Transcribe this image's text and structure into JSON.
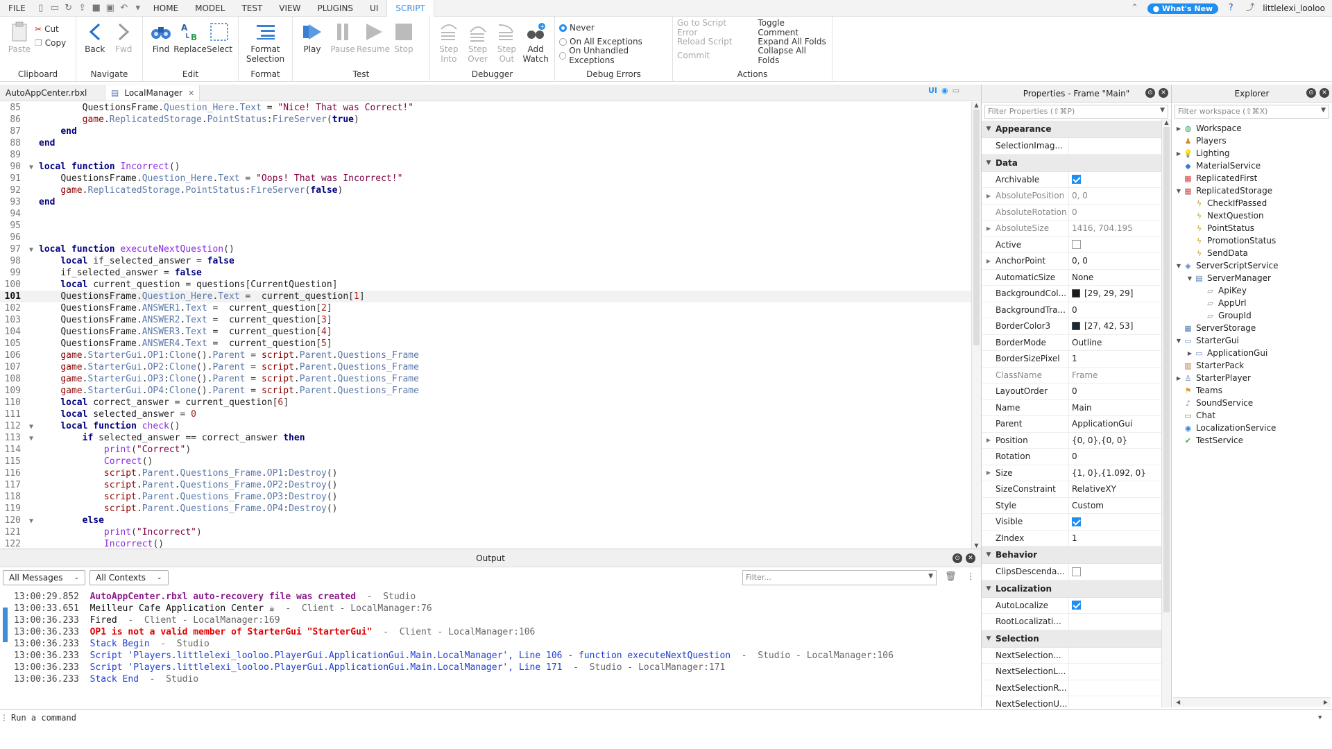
{
  "menubar": {
    "tabs": [
      "FILE",
      "HOME",
      "MODEL",
      "TEST",
      "VIEW",
      "PLUGINS",
      "UI",
      "SCRIPT"
    ],
    "active_tab": "SCRIPT",
    "whats_new": "What's New",
    "username": "littlelexi_looloo"
  },
  "ribbon": {
    "clipboard": {
      "label": "Clipboard",
      "paste": "Paste",
      "cut": "Cut",
      "copy": "Copy"
    },
    "navigate": {
      "label": "Navigate",
      "back": "Back",
      "fwd": "Fwd"
    },
    "edit": {
      "label": "Edit",
      "find": "Find",
      "replace": "Replace",
      "select": "Select"
    },
    "format": {
      "label": "Format",
      "format_selection": "Format Selection"
    },
    "test": {
      "label": "Test",
      "play": "Play",
      "pause": "Pause",
      "resume": "Resume",
      "stop": "Stop"
    },
    "debugger": {
      "label": "Debugger",
      "step_into": "Step Into",
      "step_over": "Step Over",
      "step_out": "Step Out",
      "add_watch": "Add Watch"
    },
    "debug_errors": {
      "label": "Debug Errors",
      "never": "Never",
      "all_exceptions": "On All Exceptions",
      "unhandled": "On Unhandled Exceptions",
      "selected": "Never"
    },
    "actions": {
      "label": "Actions",
      "goto_error": "Go to Script Error",
      "reload": "Reload Script",
      "commit": "Commit",
      "toggle_comment": "Toggle Comment",
      "expand_folds": "Expand All Folds",
      "collapse_folds": "Collapse All Folds"
    }
  },
  "doc_tabs": [
    {
      "label": "AutoAppCenter.rbxl",
      "close": "✕"
    },
    {
      "label": "LocalManager",
      "close": "✕"
    }
  ],
  "ui_toggle": "UI",
  "editor": {
    "current_line": 101,
    "lines": [
      {
        "n": 85,
        "code": "        QuestionsFrame.Question_Here.Text = \"Nice! That was Correct!\"",
        "fold": ""
      },
      {
        "n": 86,
        "code": "        game.ReplicatedStorage.PointStatus:FireServer(true)",
        "fold": ""
      },
      {
        "n": 87,
        "code": "    end",
        "fold": ""
      },
      {
        "n": 88,
        "code": "end",
        "fold": ""
      },
      {
        "n": 89,
        "code": "",
        "fold": ""
      },
      {
        "n": 90,
        "code": "local function Incorrect()",
        "fold": "▼"
      },
      {
        "n": 91,
        "code": "    QuestionsFrame.Question_Here.Text = \"Oops! That was Incorrect!\"",
        "fold": ""
      },
      {
        "n": 92,
        "code": "    game.ReplicatedStorage.PointStatus:FireServer(false)",
        "fold": ""
      },
      {
        "n": 93,
        "code": "end",
        "fold": ""
      },
      {
        "n": 94,
        "code": "",
        "fold": ""
      },
      {
        "n": 95,
        "code": "",
        "fold": ""
      },
      {
        "n": 96,
        "code": "",
        "fold": ""
      },
      {
        "n": 97,
        "code": "local function executeNextQuestion()",
        "fold": "▼"
      },
      {
        "n": 98,
        "code": "    local if_selected_answer = false",
        "fold": ""
      },
      {
        "n": 99,
        "code": "    if_selected_answer = false",
        "fold": ""
      },
      {
        "n": 100,
        "code": "    local current_question = questions[CurrentQuestion]",
        "fold": ""
      },
      {
        "n": 101,
        "code": "    QuestionsFrame.Question_Here.Text =  current_question[1]",
        "fold": ""
      },
      {
        "n": 102,
        "code": "    QuestionsFrame.ANSWER1.Text =  current_question[2]",
        "fold": ""
      },
      {
        "n": 103,
        "code": "    QuestionsFrame.ANSWER2.Text =  current_question[3]",
        "fold": ""
      },
      {
        "n": 104,
        "code": "    QuestionsFrame.ANSWER3.Text =  current_question[4]",
        "fold": ""
      },
      {
        "n": 105,
        "code": "    QuestionsFrame.ANSWER4.Text =  current_question[5]",
        "fold": ""
      },
      {
        "n": 106,
        "code": "    game.StarterGui.OP1:Clone().Parent = script.Parent.Questions_Frame",
        "fold": ""
      },
      {
        "n": 107,
        "code": "    game.StarterGui.OP2:Clone().Parent = script.Parent.Questions_Frame",
        "fold": ""
      },
      {
        "n": 108,
        "code": "    game.StarterGui.OP3:Clone().Parent = script.Parent.Questions_Frame",
        "fold": ""
      },
      {
        "n": 109,
        "code": "    game.StarterGui.OP4:Clone().Parent = script.Parent.Questions_Frame",
        "fold": ""
      },
      {
        "n": 110,
        "code": "    local correct_answer = current_question[6]",
        "fold": ""
      },
      {
        "n": 111,
        "code": "    local selected_answer = 0",
        "fold": ""
      },
      {
        "n": 112,
        "code": "    local function check()",
        "fold": "▼"
      },
      {
        "n": 113,
        "code": "        if selected_answer == correct_answer then",
        "fold": "▼"
      },
      {
        "n": 114,
        "code": "            print(\"Correct\")",
        "fold": ""
      },
      {
        "n": 115,
        "code": "            Correct()",
        "fold": ""
      },
      {
        "n": 116,
        "code": "            script.Parent.Questions_Frame.OP1:Destroy()",
        "fold": ""
      },
      {
        "n": 117,
        "code": "            script.Parent.Questions_Frame.OP2:Destroy()",
        "fold": ""
      },
      {
        "n": 118,
        "code": "            script.Parent.Questions_Frame.OP3:Destroy()",
        "fold": ""
      },
      {
        "n": 119,
        "code": "            script.Parent.Questions_Frame.OP4:Destroy()",
        "fold": ""
      },
      {
        "n": 120,
        "code": "        else",
        "fold": "▼"
      },
      {
        "n": 121,
        "code": "            print(\"Incorrect\")",
        "fold": ""
      },
      {
        "n": 122,
        "code": "            Incorrect()",
        "fold": ""
      }
    ]
  },
  "properties": {
    "title": "Properties - Frame \"Main\"",
    "filter_placeholder": "Filter Properties (⇧⌘P)",
    "sections": [
      {
        "name": "Appearance",
        "rows": [
          {
            "name": "SelectionImag...",
            "value": "",
            "kind": "text"
          }
        ]
      },
      {
        "name": "Data",
        "rows": [
          {
            "name": "Archivable",
            "value": "true",
            "kind": "check"
          },
          {
            "name": "AbsolutePosition",
            "value": "0, 0",
            "kind": "text",
            "ro": true,
            "exp": true
          },
          {
            "name": "AbsoluteRotation",
            "value": "0",
            "kind": "text",
            "ro": true
          },
          {
            "name": "AbsoluteSize",
            "value": "1416, 704.195",
            "kind": "text",
            "ro": true,
            "exp": true
          },
          {
            "name": "Active",
            "value": "false",
            "kind": "check"
          },
          {
            "name": "AnchorPoint",
            "value": "0, 0",
            "kind": "text",
            "exp": true
          },
          {
            "name": "AutomaticSize",
            "value": "None",
            "kind": "text"
          },
          {
            "name": "BackgroundCol...",
            "value": "[29, 29, 29]",
            "kind": "color",
            "color": "#1d1d1d"
          },
          {
            "name": "BackgroundTra...",
            "value": "0",
            "kind": "text"
          },
          {
            "name": "BorderColor3",
            "value": "[27, 42, 53]",
            "kind": "color",
            "color": "#1b2a35"
          },
          {
            "name": "BorderMode",
            "value": "Outline",
            "kind": "text"
          },
          {
            "name": "BorderSizePixel",
            "value": "1",
            "kind": "text"
          },
          {
            "name": "ClassName",
            "value": "Frame",
            "kind": "text",
            "ro": true
          },
          {
            "name": "LayoutOrder",
            "value": "0",
            "kind": "text"
          },
          {
            "name": "Name",
            "value": "Main",
            "kind": "text"
          },
          {
            "name": "Parent",
            "value": "ApplicationGui",
            "kind": "text"
          },
          {
            "name": "Position",
            "value": "{0, 0},{0, 0}",
            "kind": "text",
            "exp": true
          },
          {
            "name": "Rotation",
            "value": "0",
            "kind": "text"
          },
          {
            "name": "Size",
            "value": "{1, 0},{1.092, 0}",
            "kind": "text",
            "exp": true
          },
          {
            "name": "SizeConstraint",
            "value": "RelativeXY",
            "kind": "text"
          },
          {
            "name": "Style",
            "value": "Custom",
            "kind": "text"
          },
          {
            "name": "Visible",
            "value": "true",
            "kind": "check"
          },
          {
            "name": "ZIndex",
            "value": "1",
            "kind": "text"
          }
        ]
      },
      {
        "name": "Behavior",
        "rows": [
          {
            "name": "ClipsDescenda...",
            "value": "false",
            "kind": "check"
          }
        ]
      },
      {
        "name": "Localization",
        "rows": [
          {
            "name": "AutoLocalize",
            "value": "true",
            "kind": "check"
          },
          {
            "name": "RootLocalizati...",
            "value": "",
            "kind": "text"
          }
        ]
      },
      {
        "name": "Selection",
        "rows": [
          {
            "name": "NextSelection...",
            "value": "",
            "kind": "text"
          },
          {
            "name": "NextSelectionL...",
            "value": "",
            "kind": "text"
          },
          {
            "name": "NextSelectionR...",
            "value": "",
            "kind": "text"
          },
          {
            "name": "NextSelectionU...",
            "value": "",
            "kind": "text"
          }
        ]
      }
    ]
  },
  "explorer": {
    "title": "Explorer",
    "filter_placeholder": "Filter workspace (⇧⌘X)",
    "items": [
      {
        "label": "Workspace",
        "depth": 0,
        "tw": "▶",
        "icon": "globe-icon",
        "color": "#3aa35a"
      },
      {
        "label": "Players",
        "depth": 0,
        "tw": "",
        "icon": "players-icon",
        "color": "#d28b2b"
      },
      {
        "label": "Lighting",
        "depth": 0,
        "tw": "▶",
        "icon": "lightbulb-icon",
        "color": "#e8c33a"
      },
      {
        "label": "MaterialService",
        "depth": 0,
        "tw": "",
        "icon": "material-icon",
        "color": "#3a7bd5"
      },
      {
        "label": "ReplicatedFirst",
        "depth": 0,
        "tw": "",
        "icon": "replicated-icon",
        "color": "#d04848"
      },
      {
        "label": "ReplicatedStorage",
        "depth": 0,
        "tw": "▼",
        "icon": "replicated-icon",
        "color": "#d04848"
      },
      {
        "label": "CheckIfPassed",
        "depth": 1,
        "tw": "",
        "icon": "remote-event-icon",
        "color": "#c99a1c"
      },
      {
        "label": "NextQuestion",
        "depth": 1,
        "tw": "",
        "icon": "remote-event-icon",
        "color": "#c99a1c"
      },
      {
        "label": "PointStatus",
        "depth": 1,
        "tw": "",
        "icon": "remote-event-icon",
        "color": "#c99a1c"
      },
      {
        "label": "PromotionStatus",
        "depth": 1,
        "tw": "",
        "icon": "remote-event-icon",
        "color": "#c99a1c"
      },
      {
        "label": "SendData",
        "depth": 1,
        "tw": "",
        "icon": "remote-event-icon",
        "color": "#c99a1c"
      },
      {
        "label": "ServerScriptService",
        "depth": 0,
        "tw": "▼",
        "icon": "server-script-icon",
        "color": "#5a7fb5"
      },
      {
        "label": "ServerManager",
        "depth": 1,
        "tw": "▼",
        "icon": "script-icon",
        "color": "#5a7fb5"
      },
      {
        "label": "ApiKey",
        "depth": 2,
        "tw": "",
        "icon": "value-icon",
        "color": "#888"
      },
      {
        "label": "AppUrl",
        "depth": 2,
        "tw": "",
        "icon": "value-icon",
        "color": "#888"
      },
      {
        "label": "GroupId",
        "depth": 2,
        "tw": "",
        "icon": "value-icon",
        "color": "#888"
      },
      {
        "label": "ServerStorage",
        "depth": 0,
        "tw": "",
        "icon": "server-storage-icon",
        "color": "#5a7fb5"
      },
      {
        "label": "StarterGui",
        "depth": 0,
        "tw": "▼",
        "icon": "gui-icon",
        "color": "#6b8fc8"
      },
      {
        "label": "ApplicationGui",
        "depth": 1,
        "tw": "▶",
        "icon": "screen-gui-icon",
        "color": "#6b8fc8"
      },
      {
        "label": "StarterPack",
        "depth": 0,
        "tw": "",
        "icon": "backpack-icon",
        "color": "#b57a3a"
      },
      {
        "label": "StarterPlayer",
        "depth": 0,
        "tw": "▶",
        "icon": "player-icon",
        "color": "#5a7fb5"
      },
      {
        "label": "Teams",
        "depth": 0,
        "tw": "",
        "icon": "teams-icon",
        "color": "#d2a23a"
      },
      {
        "label": "SoundService",
        "depth": 0,
        "tw": "",
        "icon": "sound-icon",
        "color": "#6a8fbf"
      },
      {
        "label": "Chat",
        "depth": 0,
        "tw": "",
        "icon": "chat-icon",
        "color": "#777"
      },
      {
        "label": "LocalizationService",
        "depth": 0,
        "tw": "",
        "icon": "localization-icon",
        "color": "#3a86d5"
      },
      {
        "label": "TestService",
        "depth": 0,
        "tw": "",
        "icon": "test-icon",
        "color": "#2fae4f"
      }
    ]
  },
  "output": {
    "title": "Output",
    "messages_filter": "All Messages",
    "contexts_filter": "All Contexts",
    "filter_placeholder": "Filter...",
    "lines": [
      {
        "time": "13:00:29.852",
        "msg": "AutoAppCenter.rbxl auto-recovery file was created",
        "suffix": "  -  Studio",
        "kind": "warn"
      },
      {
        "time": "13:00:33.651",
        "msg": "Meilleur Cafe Application Center ☕",
        "suffix": "  -  Client - LocalManager:76",
        "kind": "info"
      },
      {
        "time": "13:00:36.233",
        "msg": "Fired",
        "suffix": "  -  Client - LocalManager:169",
        "kind": "info"
      },
      {
        "time": "13:00:36.233",
        "msg": "OP1 is not a valid member of StarterGui \"StarterGui\"",
        "suffix": "  -  Client - LocalManager:106",
        "kind": "error"
      },
      {
        "time": "13:00:36.233",
        "msg": "Stack Begin",
        "suffix": "  -  Studio",
        "kind": "stack"
      },
      {
        "time": "13:00:36.233",
        "msg": "Script 'Players.littlelexi_looloo.PlayerGui.ApplicationGui.Main.LocalManager', Line 106 - function executeNextQuestion",
        "suffix": "  -  Studio - LocalManager:106",
        "kind": "stack"
      },
      {
        "time": "13:00:36.233",
        "msg": "Script 'Players.littlelexi_looloo.PlayerGui.ApplicationGui.Main.LocalManager', Line 171",
        "suffix": "  -  Studio - LocalManager:171",
        "kind": "stack"
      },
      {
        "time": "13:00:36.233",
        "msg": "Stack End",
        "suffix": "  -  Studio",
        "kind": "stack"
      }
    ]
  },
  "command_bar": {
    "placeholder": "Run a command"
  }
}
